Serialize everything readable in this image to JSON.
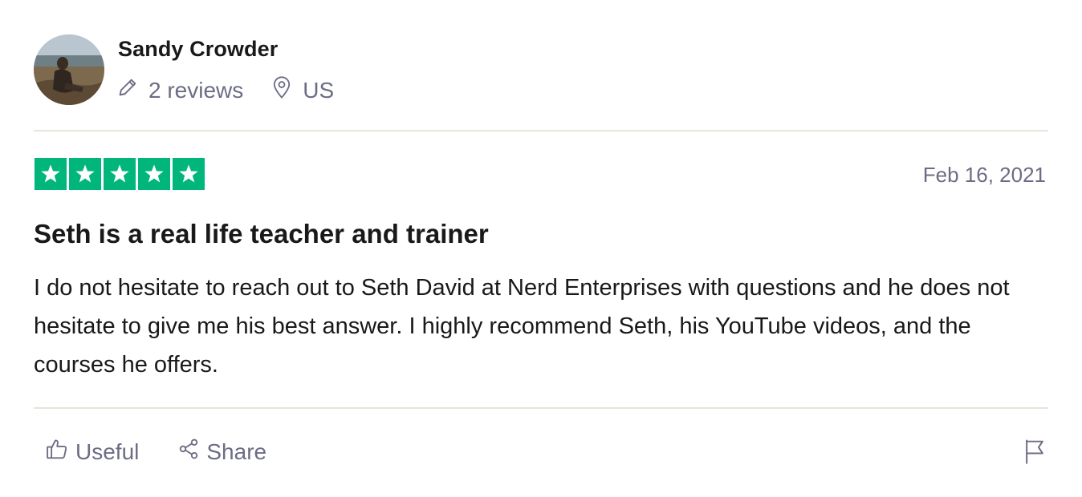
{
  "reviewer": {
    "name": "Sandy Crowder",
    "reviews_count": "2 reviews",
    "location": "US"
  },
  "review": {
    "rating": 5,
    "max_rating": 5,
    "date": "Feb 16, 2021",
    "title": "Seth is a real life teacher and trainer",
    "body": "I do not hesitate to reach out to Seth David at Nerd Enterprises with questions and he does not hesitate to give me his best answer. I highly recommend Seth, his YouTube videos, and the courses he offers."
  },
  "actions": {
    "useful_label": "Useful",
    "share_label": "Share"
  },
  "colors": {
    "star_green": "#00b67a",
    "muted_text": "#6c6c85",
    "divider": "#e5e5dd"
  },
  "icons": {
    "reviews": "pencil-icon",
    "location": "map-pin-icon",
    "useful": "thumbs-up-icon",
    "share": "share-icon",
    "report": "flag-icon"
  }
}
